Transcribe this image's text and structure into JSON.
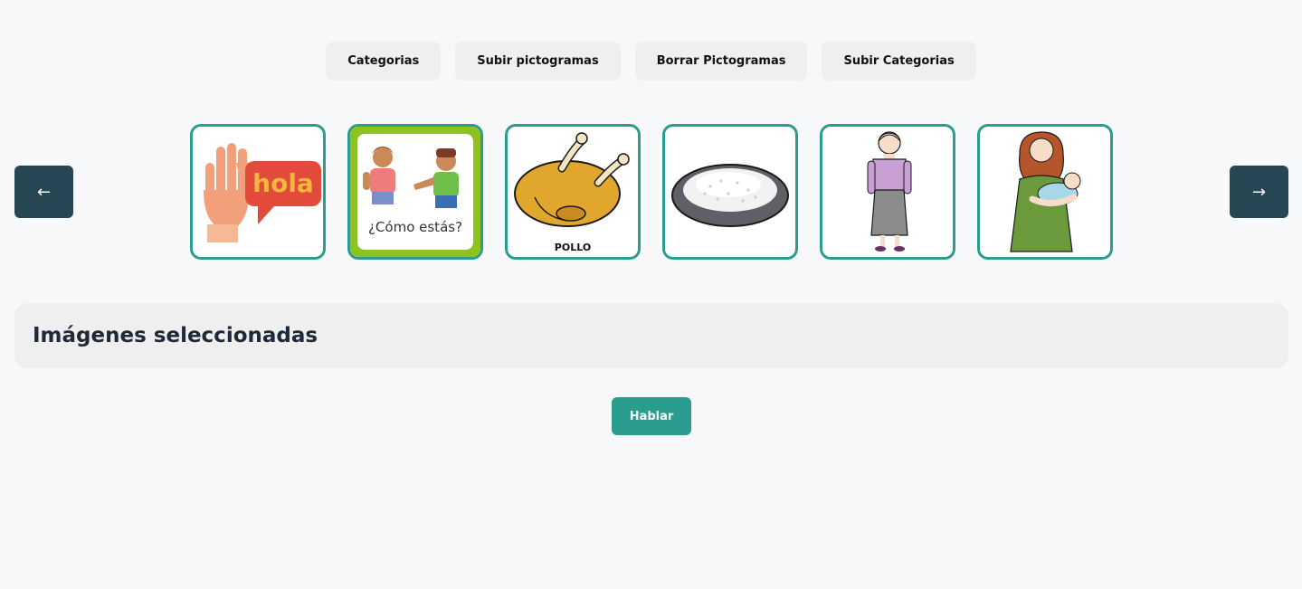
{
  "nav": {
    "categories": "Categorias",
    "upload_pictograms": "Subir pictogramas",
    "delete_pictograms": "Borrar Pictogramas",
    "upload_categories": "Subir Categorias"
  },
  "carousel": {
    "prev_icon": "←",
    "next_icon": "→",
    "cards": [
      {
        "icon": "hand-hola-icon",
        "text": "hola"
      },
      {
        "icon": "greeting-people-icon",
        "text": "¿Cómo estás?"
      },
      {
        "icon": "roast-chicken-icon",
        "text": "POLLO"
      },
      {
        "icon": "rice-plate-icon"
      },
      {
        "icon": "grandmother-icon"
      },
      {
        "icon": "mother-baby-icon"
      }
    ]
  },
  "selected": {
    "title": "Imágenes seleccionadas"
  },
  "speak_button": "Hablar",
  "colors": {
    "accent": "#2a9d8f",
    "dark": "#264653",
    "background": "#f7f8fa"
  }
}
